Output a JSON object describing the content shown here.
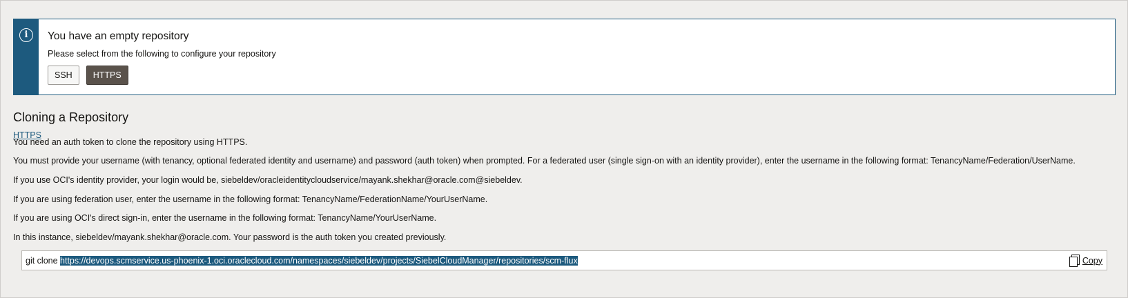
{
  "banner": {
    "icon": "info-icon",
    "title": "You have an empty repository",
    "subtitle": "Please select from the following to configure your repository",
    "buttons": {
      "ssh": "SSH",
      "https": "HTTPS",
      "selected": "HTTPS"
    }
  },
  "section": {
    "title": "Cloning a Repository",
    "link": "HTTPS",
    "paragraphs": [
      "You need an auth token to clone the repository using HTTPS.",
      "You must provide your username (with tenancy, optional federated identity and username) and password (auth token) when prompted. For a federated user (single sign-on with an identity provider), enter the username in the following format: TenancyName/Federation/UserName.",
      "If you use OCI's identity provider, your login would be, siebeldev/oracleidentitycloudservice/mayank.shekhar@oracle.com@siebeldev.",
      "If you are using federation user, enter the username in the following format: TenancyName/FederationName/YourUserName.",
      "If you are using OCI's direct sign-in, enter the username in the following format: TenancyName/YourUserName.",
      "In this instance, siebeldev/mayank.shekhar@oracle.com. Your password is the auth token you created previously."
    ]
  },
  "clone": {
    "command": "git clone ",
    "url": "https://devops.scmservice.us-phoenix-1.oci.oraclecloud.com/namespaces/siebeldev/projects/SiebelCloudManager/repositories/scm-flux",
    "copy_label": "Copy",
    "copy_icon": "copy-icon"
  },
  "colors": {
    "accent": "#1d5a7e",
    "selected_button": "#5a524b",
    "background": "#efeeec"
  }
}
